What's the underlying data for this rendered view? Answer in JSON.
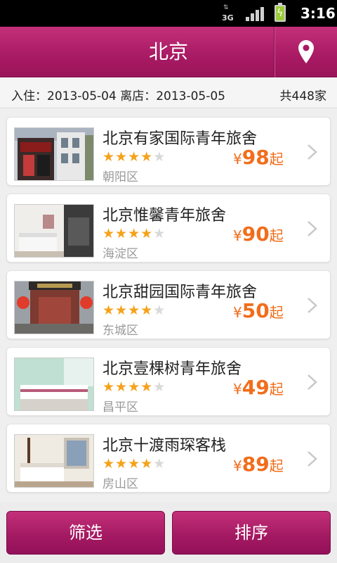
{
  "status_bar": {
    "network": "3G",
    "time": "3:16",
    "icons": [
      "network-3g-icon",
      "signal-icon",
      "battery-charging-icon"
    ]
  },
  "header": {
    "title": "北京",
    "location_icon": "location-pin-icon"
  },
  "info": {
    "dates": "入住：2013-05-04 离店：2013-05-05",
    "count": "共448家"
  },
  "colors": {
    "brand": "#a81a63",
    "price": "#f26d1b",
    "star": "#f5a21a"
  },
  "hotels": [
    {
      "name": "北京有家国际青年旅舍",
      "rating": 4,
      "max_rating": 5,
      "district": "朝阳区",
      "currency": "¥",
      "price": "98",
      "suffix": "起"
    },
    {
      "name": "北京惟馨青年旅舍",
      "rating": 4,
      "max_rating": 5,
      "district": "海淀区",
      "currency": "¥",
      "price": "90",
      "suffix": "起"
    },
    {
      "name": "北京甜园国际青年旅舍",
      "rating": 4,
      "max_rating": 5,
      "district": "东城区",
      "currency": "¥",
      "price": "50",
      "suffix": "起"
    },
    {
      "name": "北京壹棵树青年旅舍",
      "rating": 4,
      "max_rating": 5,
      "district": "昌平区",
      "currency": "¥",
      "price": "49",
      "suffix": "起"
    },
    {
      "name": "北京十渡雨琛客栈",
      "rating": 4,
      "max_rating": 5,
      "district": "房山区",
      "currency": "¥",
      "price": "89",
      "suffix": "起"
    }
  ],
  "bottom": {
    "filter_label": "筛选",
    "sort_label": "排序"
  }
}
